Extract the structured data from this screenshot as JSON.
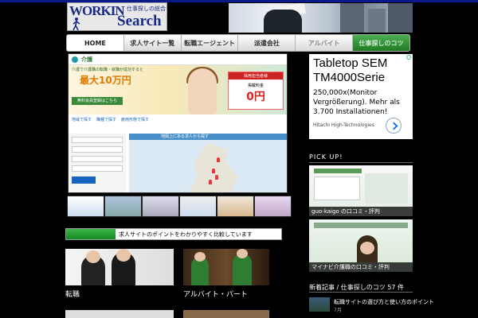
{
  "logo": {
    "word1": "WORKIN",
    "word2": "Search",
    "tagline": "仕事探しの総合サイト"
  },
  "nav": {
    "items": [
      {
        "label": "HOME",
        "state": "home"
      },
      {
        "label": "求人サイト一覧",
        "state": "normal"
      },
      {
        "label": "転職エージェント",
        "state": "normal"
      },
      {
        "label": "派遣会社",
        "state": "normal"
      },
      {
        "label": "アルバイト",
        "state": "dim"
      },
      {
        "label": "仕事探しのコツ",
        "state": "active"
      }
    ]
  },
  "shot": {
    "brand": "介護",
    "hero_sub": "介護で介護職の転職・就職が成功すると",
    "hero_big": "最大10万円",
    "card_title": "採用担当者様",
    "card_sub": "掲載料金",
    "card_zero": "0円",
    "cta": "無料会員登録はこちら",
    "tabs": [
      "地域で探す",
      "職種で探す",
      "雇用形態で探す"
    ],
    "map_title": "地図上にある求人から探す"
  },
  "progress": {
    "label": "求人サイトのポイントをわかりやすく比較しています",
    "value": 0.23
  },
  "cards": [
    {
      "label": "転職"
    },
    {
      "label": "アルバイト・パート"
    },
    {
      "label": ""
    },
    {
      "label": ""
    }
  ],
  "ad": {
    "line1": "Tabletop SEM",
    "line2": "TM4000Serie",
    "desc": "250,000x(Monitor Vergrößerung). Mehr als 3.700 Installationen!",
    "advertiser": "Hitachi High-Technologies"
  },
  "pickup": {
    "title": "PICK UP!",
    "items": [
      {
        "caption": "guo-kaigo の口コミ・評判"
      },
      {
        "caption": "マイナビ介護職の口コミ・評判"
      }
    ]
  },
  "news": {
    "title": "新着記事 / 仕事探しのコツ 57 件",
    "items": [
      {
        "text": "転職サイトの選び方と使い方のポイント",
        "date": "7月"
      }
    ]
  },
  "colors": {
    "accent": "#1f7a24",
    "nav_bg": "#d9d9d9",
    "top_line": "#0b1a8a"
  }
}
